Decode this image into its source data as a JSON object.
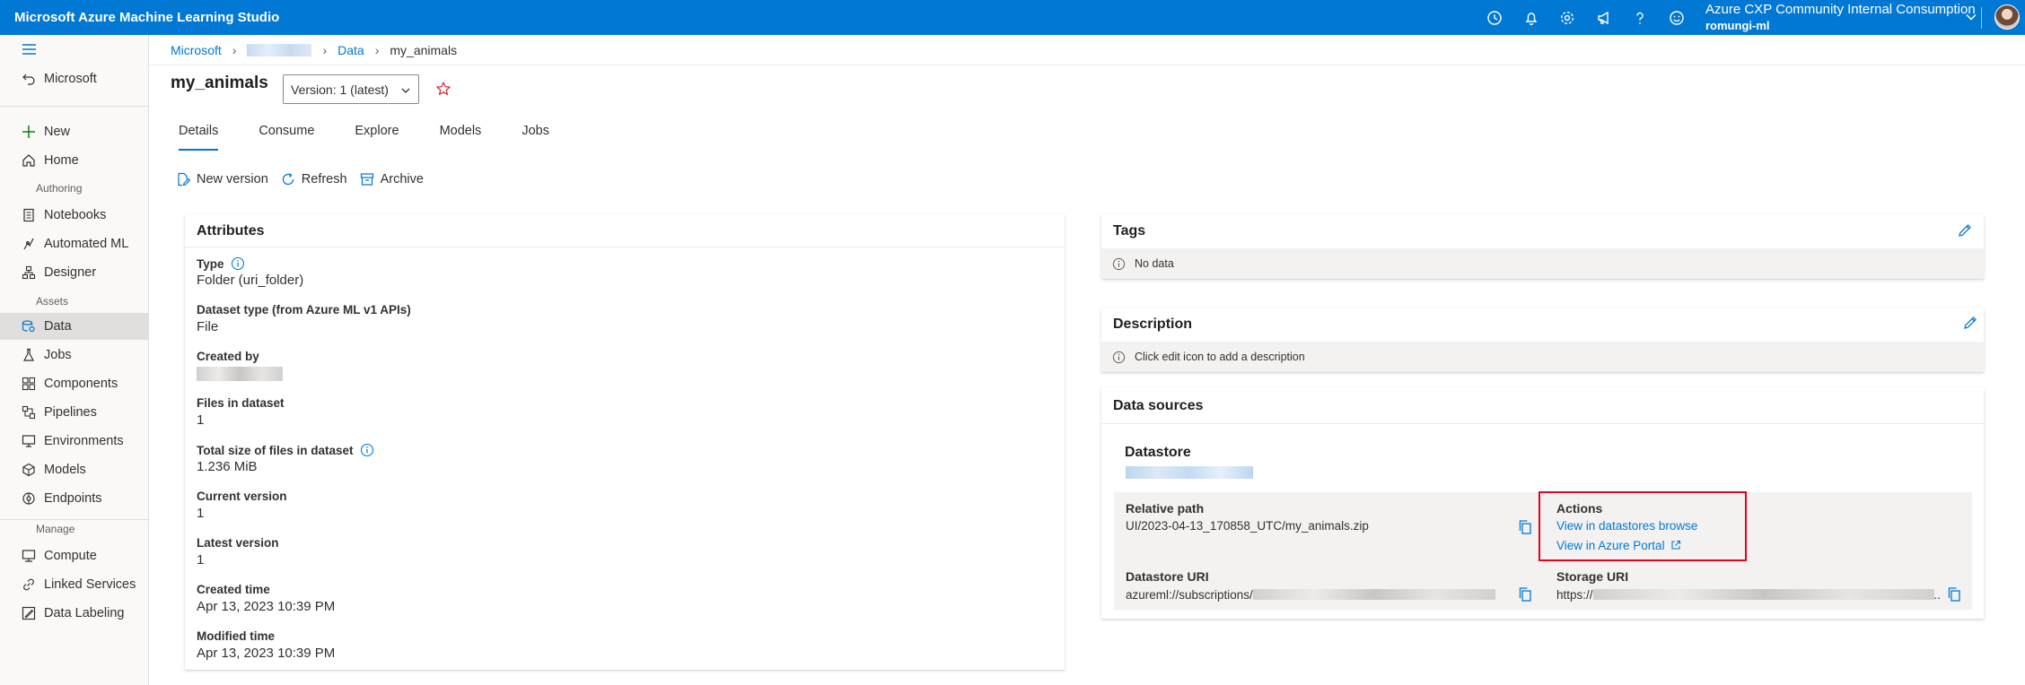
{
  "app": {
    "title": "Microsoft Azure Machine Learning Studio"
  },
  "account": {
    "name": "Azure CXP Community Internal Consumption",
    "workspace": "romungi-ml"
  },
  "top_icons": [
    "history-icon",
    "bell-icon",
    "gear-icon",
    "megaphone-icon",
    "help-icon",
    "smiley-icon"
  ],
  "sidebar": {
    "back": "Microsoft",
    "new": "New",
    "home": "Home",
    "sections": {
      "authoring": "Authoring",
      "assets": "Assets",
      "manage": "Manage"
    },
    "authoring": [
      "Notebooks",
      "Automated ML",
      "Designer"
    ],
    "assets": [
      "Data",
      "Jobs",
      "Components",
      "Pipelines",
      "Environments",
      "Models",
      "Endpoints"
    ],
    "manage": [
      "Compute",
      "Linked Services",
      "Data Labeling"
    ],
    "active": "Data"
  },
  "breadcrumb": {
    "root": "Microsoft",
    "data": "Data",
    "current": "my_animals"
  },
  "page": {
    "title": "my_animals",
    "version": "Version: 1 (latest)",
    "tabs": [
      "Details",
      "Consume",
      "Explore",
      "Models",
      "Jobs"
    ],
    "active_tab": "Details",
    "toolbar": {
      "new_version": "New version",
      "refresh": "Refresh",
      "archive": "Archive"
    }
  },
  "attributes": {
    "title": "Attributes",
    "type_label": "Type",
    "type_value": "Folder (uri_folder)",
    "dataset_type_label": "Dataset type (from Azure ML v1 APIs)",
    "dataset_type_value": "File",
    "created_by_label": "Created by",
    "files_label": "Files in dataset",
    "files_value": "1",
    "size_label": "Total size of files in dataset",
    "size_value": "1.236 MiB",
    "current_version_label": "Current version",
    "current_version_value": "1",
    "latest_version_label": "Latest version",
    "latest_version_value": "1",
    "created_time_label": "Created time",
    "created_time_value": "Apr 13, 2023 10:39 PM",
    "modified_time_label": "Modified time",
    "modified_time_value": "Apr 13, 2023 10:39 PM"
  },
  "tags": {
    "title": "Tags",
    "empty": "No data"
  },
  "description": {
    "title": "Description",
    "empty": "Click edit icon to add a description"
  },
  "data_sources": {
    "title": "Data sources",
    "datastore_label": "Datastore",
    "relative_path_label": "Relative path",
    "relative_path_value": "UI/2023-04-13_170858_UTC/my_animals.zip",
    "actions_label": "Actions",
    "view_datastores": "View in datastores browse",
    "view_portal": "View in Azure Portal",
    "datastore_uri_label": "Datastore URI",
    "datastore_uri_prefix": "azureml://subscriptions/",
    "storage_uri_label": "Storage URI",
    "storage_uri_prefix": "https://",
    "storage_uri_suffix": ".."
  },
  "colors": {
    "brand": "#0078d4",
    "highlight": "#e8001c",
    "star": "#d13438"
  }
}
